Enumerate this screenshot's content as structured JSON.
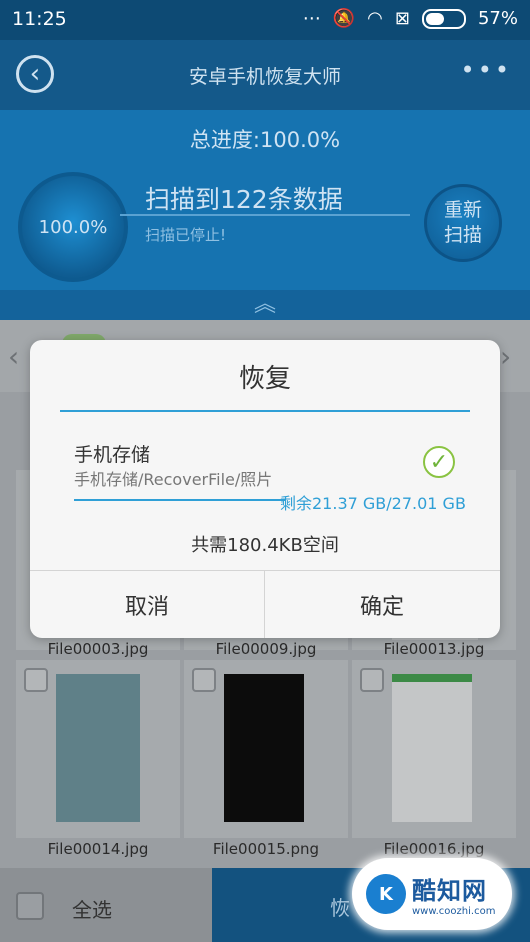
{
  "status_bar": {
    "time": "11:25",
    "battery": "57%",
    "battery_level": 0.57
  },
  "app_bar": {
    "title": "安卓手机恢复大师"
  },
  "scan_panel": {
    "total_progress": "总进度:100.0%",
    "ring_percent": "100.0%",
    "scan_count": "扫描到122条数据",
    "scan_status": "扫描已停止!",
    "rescan_line1": "重新",
    "rescan_line2": "扫描"
  },
  "gallery": {
    "files": [
      "File00003.jpg",
      "File00009.jpg",
      "File00013.jpg",
      "File00014.jpg",
      "File00015.png",
      "File00016.jpg"
    ]
  },
  "bottom_bar": {
    "select_all": "全选",
    "restore": "恢"
  },
  "watermark": {
    "name": "酷知网",
    "url": "www.coozhi.com"
  },
  "dialog": {
    "title": "恢复",
    "storage_name": "手机存储",
    "storage_path": "手机存储/RecoverFile/照片",
    "storage_free": "剩余21.37 GB/27.01 GB",
    "space_required": "共需180.4KB空间",
    "cancel": "取消",
    "confirm": "确定"
  },
  "colors": {
    "accent": "#2f9fd6",
    "check": "#8ac342",
    "app_blue": "#1673b0"
  }
}
